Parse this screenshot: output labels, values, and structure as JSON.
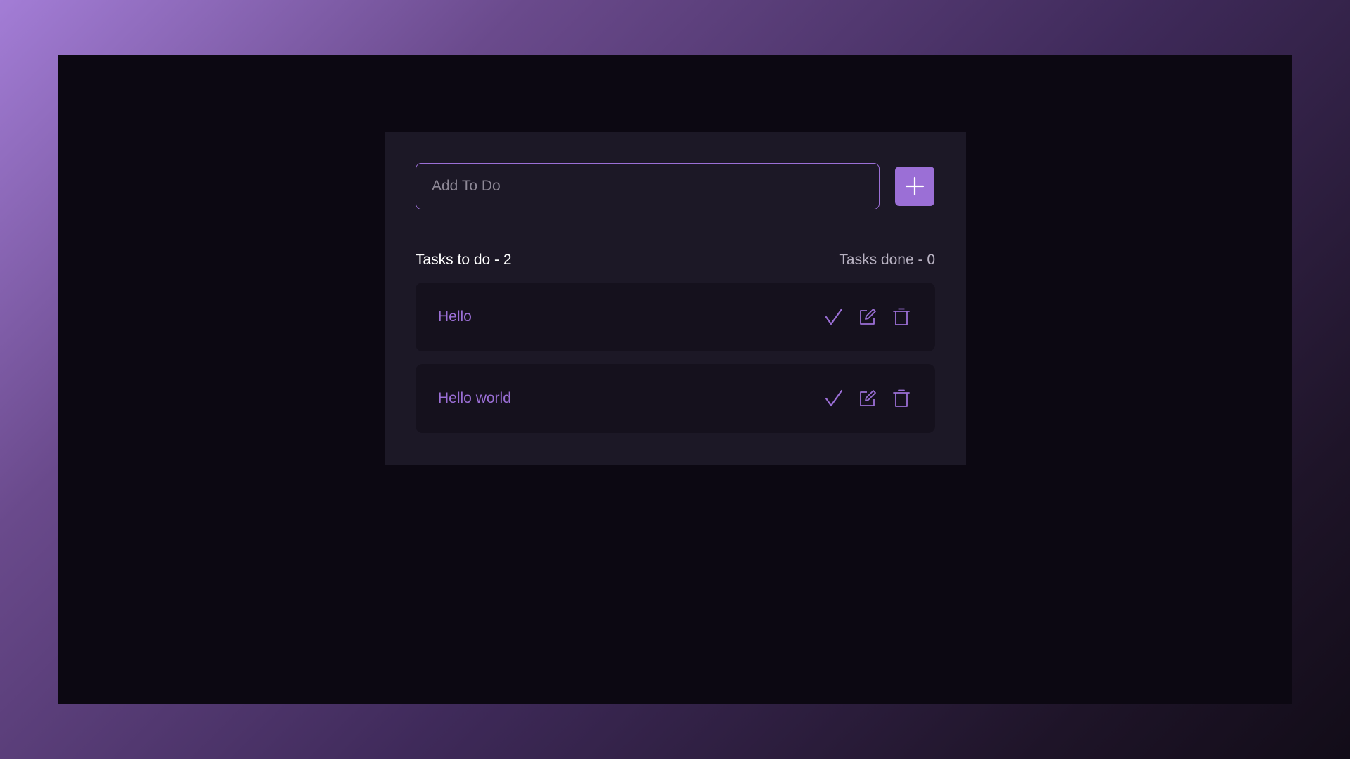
{
  "input": {
    "placeholder": "Add To Do",
    "value": ""
  },
  "add_button": {
    "icon": "plus-icon"
  },
  "summary": {
    "todo_label": "Tasks to do - 2",
    "done_label": "Tasks done - 0"
  },
  "tasks": [
    {
      "text": "Hello",
      "actions": [
        "check-icon",
        "edit-icon",
        "trash-icon"
      ]
    },
    {
      "text": "Hello world",
      "actions": [
        "check-icon",
        "edit-icon",
        "trash-icon"
      ]
    }
  ],
  "colors": {
    "accent": "#9b6fd6",
    "card_background": "#1c1826",
    "item_background": "#15111d",
    "frame_background": "#0c0812"
  }
}
